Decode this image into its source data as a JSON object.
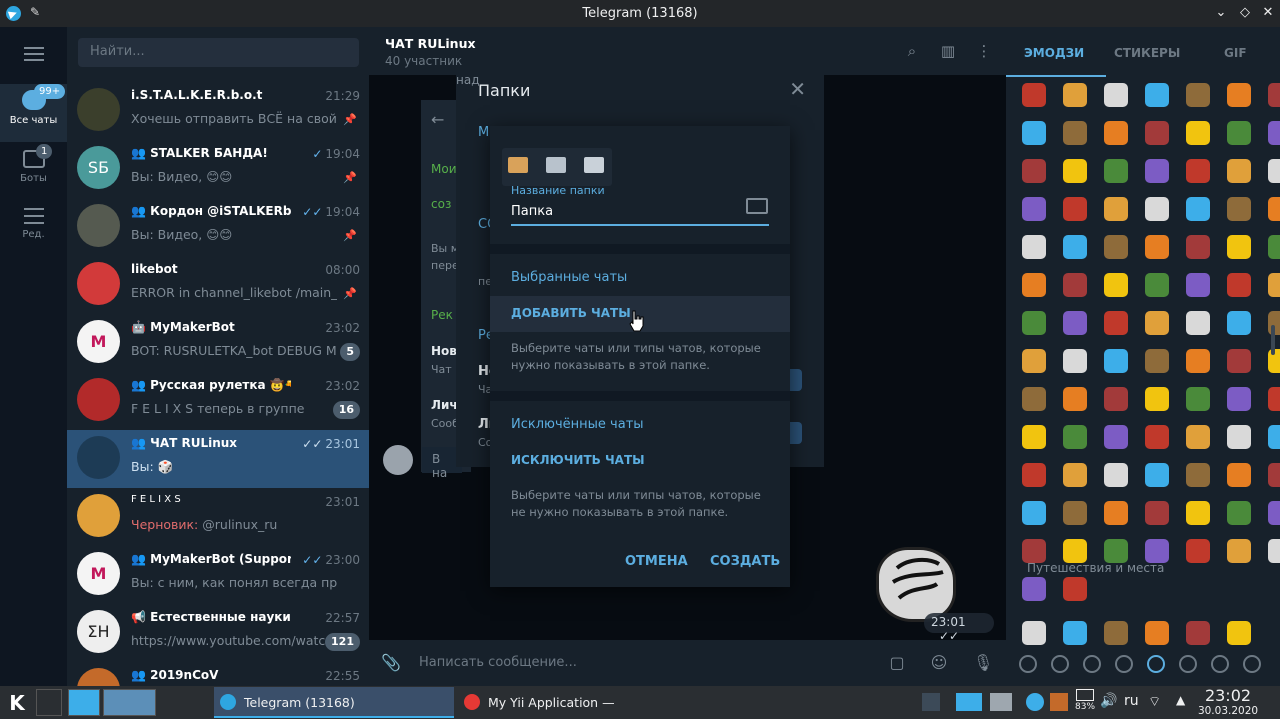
{
  "window": {
    "title": "Telegram (13168)"
  },
  "rail": {
    "items": [
      {
        "label": "Все чаты",
        "badge": "99+"
      },
      {
        "label": "Боты",
        "badge": "1"
      },
      {
        "label": "Ред."
      }
    ]
  },
  "search": {
    "placeholder": "Найти..."
  },
  "chats": [
    {
      "name": "i.S.T.A.L.K.E.R.b.o.t",
      "time": "21:29",
      "preview": "Хочешь отправить ВСЁ на свой с...",
      "avatar_text": "",
      "avatar_color": "#3b3f2c",
      "group": false
    },
    {
      "name": "STALKER БАНДА!",
      "time": "19:04",
      "preview": "Вы: Видео, 😊😊",
      "avatar_text": "SБ",
      "avatar_color": "#4a9a9a",
      "group": true
    },
    {
      "name": "Кордон @iSTALKERbot",
      "time": "19:04",
      "preview": "Вы: Видео, 😊😊",
      "avatar_text": "",
      "avatar_color": "#555a50",
      "group": true
    },
    {
      "name": "likebot",
      "time": "08:00",
      "preview": "ERROR in channel_likebot /main_...",
      "avatar_text": "",
      "avatar_color": "#d23a3a",
      "group": false
    },
    {
      "name": "MyMakerBot",
      "time": "23:02",
      "preview": "BOT: RUSRULETKA_bot DEBUG ME...",
      "avatar_text": "M",
      "avatar_color": "#f4f4f4",
      "count": "5",
      "group": false
    },
    {
      "name": "Русская рулетка 🤠🔫",
      "time": "23:02",
      "preview": "F E L I X S теперь в группе",
      "avatar_text": "",
      "avatar_color": "#b22a2a",
      "count": "16",
      "group": true
    },
    {
      "name": "ЧАТ RULinux",
      "time": "23:01",
      "preview": "Вы: 🎲",
      "avatar_text": "",
      "avatar_color": "#1d3b55",
      "group": true,
      "active": true
    },
    {
      "name": "F E L I X S",
      "time": "23:01",
      "preview_draft": "Черновик:",
      "preview": " @rulinux_ru",
      "avatar_text": "",
      "avatar_color": "#e0a03a",
      "group": false
    },
    {
      "name": "MyMakerBot (Support)",
      "time": "23:00",
      "preview": "Вы: с ним, как понял всегда проблем...",
      "avatar_text": "M",
      "avatar_color": "#f4f4f4",
      "group": true
    },
    {
      "name": "Естественные науки",
      "time": "22:57",
      "preview": "https://www.youtube.com/watc...",
      "avatar_text": "ΣH",
      "avatar_color": "#eeeeee",
      "count": "121",
      "group": false,
      "channel": true
    },
    {
      "name": "2019nCoV",
      "time": "22:55",
      "preview": "",
      "avatar_text": "",
      "avatar_color": "#c46a2a",
      "group": true
    }
  ],
  "middle": {
    "title": "ЧАТ RULinux",
    "subtitle": "40 участник",
    "composer_placeholder": "Написать сообщение...",
    "bubble_text": "В на",
    "sticker_time": "23:01"
  },
  "folders_dialog": {
    "title": "Папки",
    "peek": [
      "над",
      "Мо",
      "Мои",
      "соз",
      "СО",
      "Вы м",
      "пере",
      "пе",
      "Рек",
      "Ре",
      "Нов",
      "Но",
      "Чат",
      "Ча",
      "Лич",
      "Ли",
      "Сооб",
      "Со"
    ]
  },
  "new_folder": {
    "name_label": "Название папки",
    "name_value": "Папка",
    "included_title": "Выбранные чаты",
    "add_label": "ДОБАВИТЬ ЧАТЫ",
    "included_hint": "Выберите чаты или типы чатов, которые нужно показывать в этой папке.",
    "excluded_title": "Исключённые чаты",
    "exclude_label": "ИСКЛЮЧИТЬ ЧАТЫ",
    "excluded_hint": "Выберите чаты или типы чатов, которые не нужно показывать в этой папке.",
    "cancel": "ОТМЕНА",
    "create": "СОЗДАТЬ"
  },
  "emoji_panel": {
    "tabs": [
      "ЭМОДЗИ",
      "СТИКЕРЫ",
      "GIF"
    ],
    "category_label": "Путешествия и места"
  },
  "taskbar": {
    "tasks": [
      {
        "label": "Telegram (13168)",
        "active": true
      },
      {
        "label": "My Yii Application — Яндекс.Браузер",
        "active": false
      }
    ],
    "battery": "83%",
    "language": "ru",
    "time": "23:02",
    "date": "30.03.2020"
  }
}
